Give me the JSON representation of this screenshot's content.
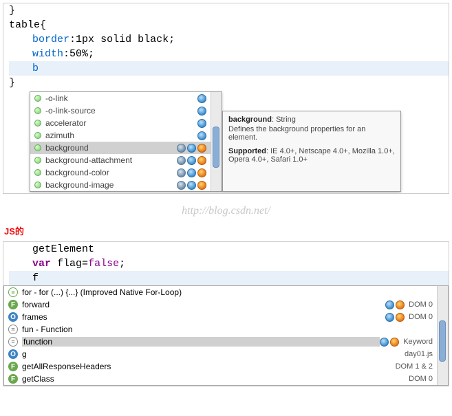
{
  "css": {
    "line0": "}",
    "selector": "table",
    "prop1": "border",
    "val1a": "1px",
    "val1b": "solid",
    "val1c": "black",
    "prop2": "width",
    "val2": "50%",
    "typed": "b",
    "close_brace": "}"
  },
  "css_suggestions": [
    {
      "label": "-o-link",
      "ie": true,
      "ff": false,
      "sf": false
    },
    {
      "label": "-o-link-source",
      "ie": true,
      "ff": false,
      "sf": false
    },
    {
      "label": "accelerator",
      "ie": true,
      "ff": false,
      "sf": false
    },
    {
      "label": "azimuth",
      "ie": true,
      "ff": false,
      "sf": false
    },
    {
      "label": "background",
      "ie": true,
      "ff": true,
      "sf": true,
      "selected": true
    },
    {
      "label": "background-attachment",
      "ie": true,
      "ff": true,
      "sf": true
    },
    {
      "label": "background-color",
      "ie": true,
      "ff": true,
      "sf": true
    },
    {
      "label": "background-image",
      "ie": true,
      "ff": true,
      "sf": true
    }
  ],
  "tooltip": {
    "name": "background",
    "type": "String",
    "desc": "Defines the background properties for an element.",
    "supp_label": "Supported",
    "supp_val": "IE 4.0+, Netscape 4.0+, Mozilla 1.0+, Opera 4.0+, Safari 1.0+"
  },
  "watermark": "http://blog.csdn.net/",
  "section_label": "JS的",
  "js": {
    "line1": "getElement",
    "kw_var": "var",
    "varname": "flag",
    "eq": "=",
    "boolv": "false",
    "typed": "f"
  },
  "js_suggestions": [
    {
      "glyph": "loop",
      "g": "≡",
      "label": "for - for (...) {...} (Improved Native For-Loop)",
      "meta": ""
    },
    {
      "glyph": "F",
      "g": "F",
      "label": "forward",
      "meta": "DOM 0",
      "ie": true,
      "ff": true
    },
    {
      "glyph": "O",
      "g": "O",
      "label": "frames",
      "meta": "DOM 0",
      "ie": true,
      "ff": true
    },
    {
      "glyph": "fn",
      "g": "=",
      "label": "fun - Function",
      "meta": ""
    },
    {
      "glyph": "fn",
      "g": "≡",
      "label": "function",
      "meta": "Keyword",
      "ie": true,
      "ff": true,
      "selected": true
    },
    {
      "glyph": "O",
      "g": "O",
      "label": "g",
      "meta": "day01.js"
    },
    {
      "glyph": "F",
      "g": "F",
      "label": "getAllResponseHeaders",
      "meta": "DOM 1 & 2"
    },
    {
      "glyph": "F",
      "g": "F",
      "label": "getClass",
      "meta": "DOM 0"
    }
  ]
}
